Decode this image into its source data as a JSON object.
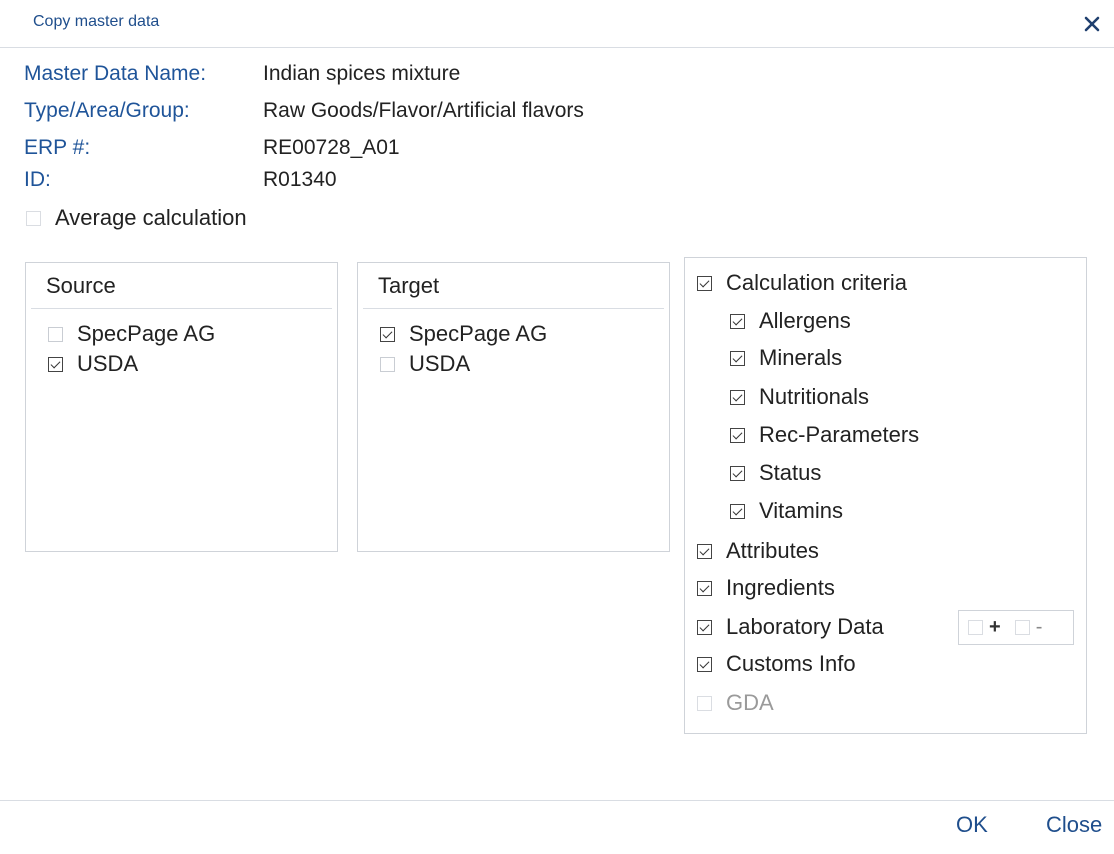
{
  "dialog": {
    "title": "Copy master data",
    "close_icon": "close-x-icon"
  },
  "info": {
    "master_data_name_label": "Master Data Name:",
    "master_data_name_value": "Indian spices mixture",
    "type_area_group_label": "Type/Area/Group:",
    "type_area_group_value": "Raw Goods/Flavor/Artificial flavors",
    "erp_label": "ERP #:",
    "erp_value": "RE00728_A01",
    "id_label": "ID:",
    "id_value": "R01340"
  },
  "average_calculation": {
    "label": "Average calculation",
    "checked": false
  },
  "source": {
    "header": "Source",
    "items": [
      {
        "label": "SpecPage AG",
        "checked": false
      },
      {
        "label": "USDA",
        "checked": true
      }
    ]
  },
  "target": {
    "header": "Target",
    "items": [
      {
        "label": "SpecPage AG",
        "checked": true
      },
      {
        "label": "USDA",
        "checked": false
      }
    ]
  },
  "criteria": {
    "calculation_criteria": {
      "label": "Calculation criteria",
      "checked": true
    },
    "sub_items": [
      {
        "label": "Allergens",
        "checked": true
      },
      {
        "label": "Minerals",
        "checked": true
      },
      {
        "label": "Nutritionals",
        "checked": true
      },
      {
        "label": "Rec-Parameters",
        "checked": true
      },
      {
        "label": "Status",
        "checked": true
      },
      {
        "label": "Vitamins",
        "checked": true
      }
    ],
    "attributes": {
      "label": "Attributes",
      "checked": true
    },
    "ingredients": {
      "label": "Ingredients",
      "checked": true
    },
    "laboratory_data": {
      "label": "Laboratory Data",
      "checked": true,
      "plus": "+",
      "minus": "-"
    },
    "customs_info": {
      "label": "Customs Info",
      "checked": true
    },
    "gda": {
      "label": "GDA",
      "checked": false,
      "disabled": true
    }
  },
  "footer": {
    "ok_label": "OK",
    "close_label": "Close"
  }
}
